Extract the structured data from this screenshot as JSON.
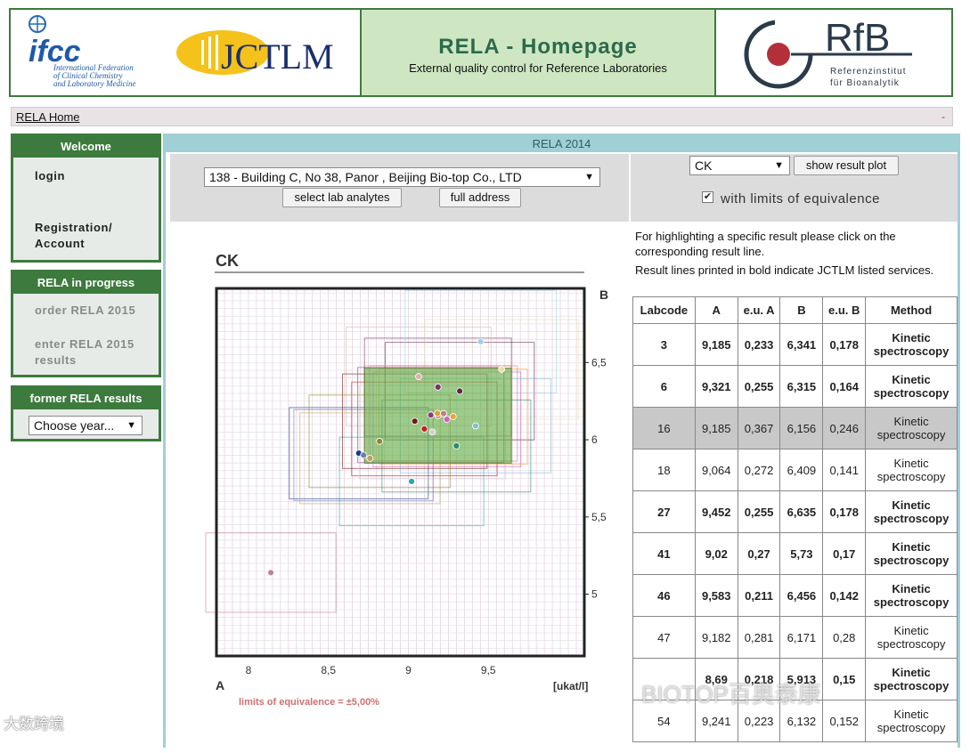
{
  "header": {
    "ifcc_logo": "ifcc",
    "ifcc_sub1": "International Federation",
    "ifcc_sub2": "of Clinical Chemistry",
    "ifcc_sub3": "and Laboratory Medicine",
    "jctlm_logo": "JCTLM",
    "title": "RELA - Homepage",
    "subtitle": "External quality control for Reference Laboratories",
    "rfb_logo": "RfB",
    "rfb_sub1": "Referenzinstitut",
    "rfb_sub2": "für Bioanalytik"
  },
  "nav": {
    "home": "RELA Home",
    "dash": "-"
  },
  "sidebar": {
    "welcome": {
      "title": "Welcome",
      "login": "login",
      "registration": "Registration/ Account"
    },
    "progress": {
      "title": "RELA in progress",
      "order": "order RELA 2015",
      "enter": "enter RELA 2015 results"
    },
    "former": {
      "title": "former RELA results",
      "select": "Choose year..."
    }
  },
  "main": {
    "title": "RELA 2014",
    "lab_select": "138 - Building C, No 38, Panor , Beijing Bio-top Co., LTD",
    "btn_analytes": "select lab analytes",
    "btn_address": "full address",
    "analyte_select": "CK",
    "btn_plot": "show result plot",
    "limits_label": "with limits of equivalence",
    "limits_checked": true,
    "help1": "For highlighting a specific result please click on the corresponding result line.",
    "help2": "Result lines printed in bold indicate JCTLM listed services."
  },
  "chart_data": {
    "type": "scatter",
    "title": "CK",
    "xlabel": "A",
    "ylabel": "B",
    "unit": "[ukat/l]",
    "footnote": "limits of equivalence = ±5,00%",
    "xlim": [
      7.8,
      10.1
    ],
    "ylim": [
      4.6,
      6.98
    ],
    "xticks": [
      "8",
      "8,5",
      "9",
      "9,5"
    ],
    "yticks": [
      "5",
      "5,5",
      "6",
      "6,5"
    ],
    "points": [
      {
        "x": 9.185,
        "y": 6.341,
        "c": "#7a3070"
      },
      {
        "x": 9.321,
        "y": 6.315,
        "c": "#5a2a40"
      },
      {
        "x": 9.185,
        "y": 6.156,
        "c": "#e08080"
      },
      {
        "x": 9.064,
        "y": 6.409,
        "c": "#e0b0b0"
      },
      {
        "x": 9.452,
        "y": 6.635,
        "c": "#9ad0f0"
      },
      {
        "x": 9.02,
        "y": 5.73,
        "c": "#2aa8a8"
      },
      {
        "x": 9.583,
        "y": 6.456,
        "c": "#f0e0a0"
      },
      {
        "x": 9.182,
        "y": 6.171,
        "c": "#e0a030"
      },
      {
        "x": 8.69,
        "y": 5.913,
        "c": "#1a3a8a"
      },
      {
        "x": 9.241,
        "y": 6.132,
        "c": "#d060c0"
      },
      {
        "x": 9.04,
        "y": 6.12,
        "c": "#6a1a1a"
      },
      {
        "x": 9.1,
        "y": 6.07,
        "c": "#c02020"
      },
      {
        "x": 9.14,
        "y": 6.16,
        "c": "#8a3a8a"
      },
      {
        "x": 9.22,
        "y": 6.17,
        "c": "#c08080"
      },
      {
        "x": 9.28,
        "y": 6.15,
        "c": "#f0a040"
      },
      {
        "x": 9.42,
        "y": 6.09,
        "c": "#80c0d0"
      },
      {
        "x": 9.15,
        "y": 6.05,
        "c": "#d0d0d0"
      },
      {
        "x": 9.3,
        "y": 5.96,
        "c": "#2a8a6a"
      },
      {
        "x": 8.82,
        "y": 5.99,
        "c": "#8a8a2a"
      },
      {
        "x": 8.72,
        "y": 5.9,
        "c": "#6a80b0"
      },
      {
        "x": 8.76,
        "y": 5.88,
        "c": "#c0a060"
      },
      {
        "x": 8.14,
        "y": 5.14,
        "c": "#c080a0"
      }
    ]
  },
  "table": {
    "headers": [
      "Labcode",
      "A",
      "e.u. A",
      "B",
      "e.u. B",
      "Method"
    ],
    "rows": [
      [
        "3",
        "9,185",
        "0,233",
        "6,341",
        "0,178",
        "Kinetic spectroscopy"
      ],
      [
        "6",
        "9,321",
        "0,255",
        "6,315",
        "0,164",
        "Kinetic spectroscopy"
      ],
      [
        "16",
        "9,185",
        "0,367",
        "6,156",
        "0,246",
        "Kinetic spectroscopy"
      ],
      [
        "18",
        "9,064",
        "0,272",
        "6,409",
        "0,141",
        "Kinetic spectroscopy"
      ],
      [
        "27",
        "9,452",
        "0,255",
        "6,635",
        "0,178",
        "Kinetic spectroscopy"
      ],
      [
        "41",
        "9,02",
        "0,27",
        "5,73",
        "0,17",
        "Kinetic spectroscopy"
      ],
      [
        "46",
        "9,583",
        "0,211",
        "6,456",
        "0,142",
        "Kinetic spectroscopy"
      ],
      [
        "47",
        "9,182",
        "0,281",
        "6,171",
        "0,28",
        "Kinetic spectroscopy"
      ],
      [
        "",
        "8,69",
        "0,218",
        "5,913",
        "0,15",
        "Kinetic spectroscopy"
      ],
      [
        "54",
        "9,241",
        "0,223",
        "6,132",
        "0,152",
        "Kinetic spectroscopy"
      ]
    ]
  },
  "watermarks": {
    "left": "大数跨境",
    "right": "BIOTOP百奥泰康"
  }
}
